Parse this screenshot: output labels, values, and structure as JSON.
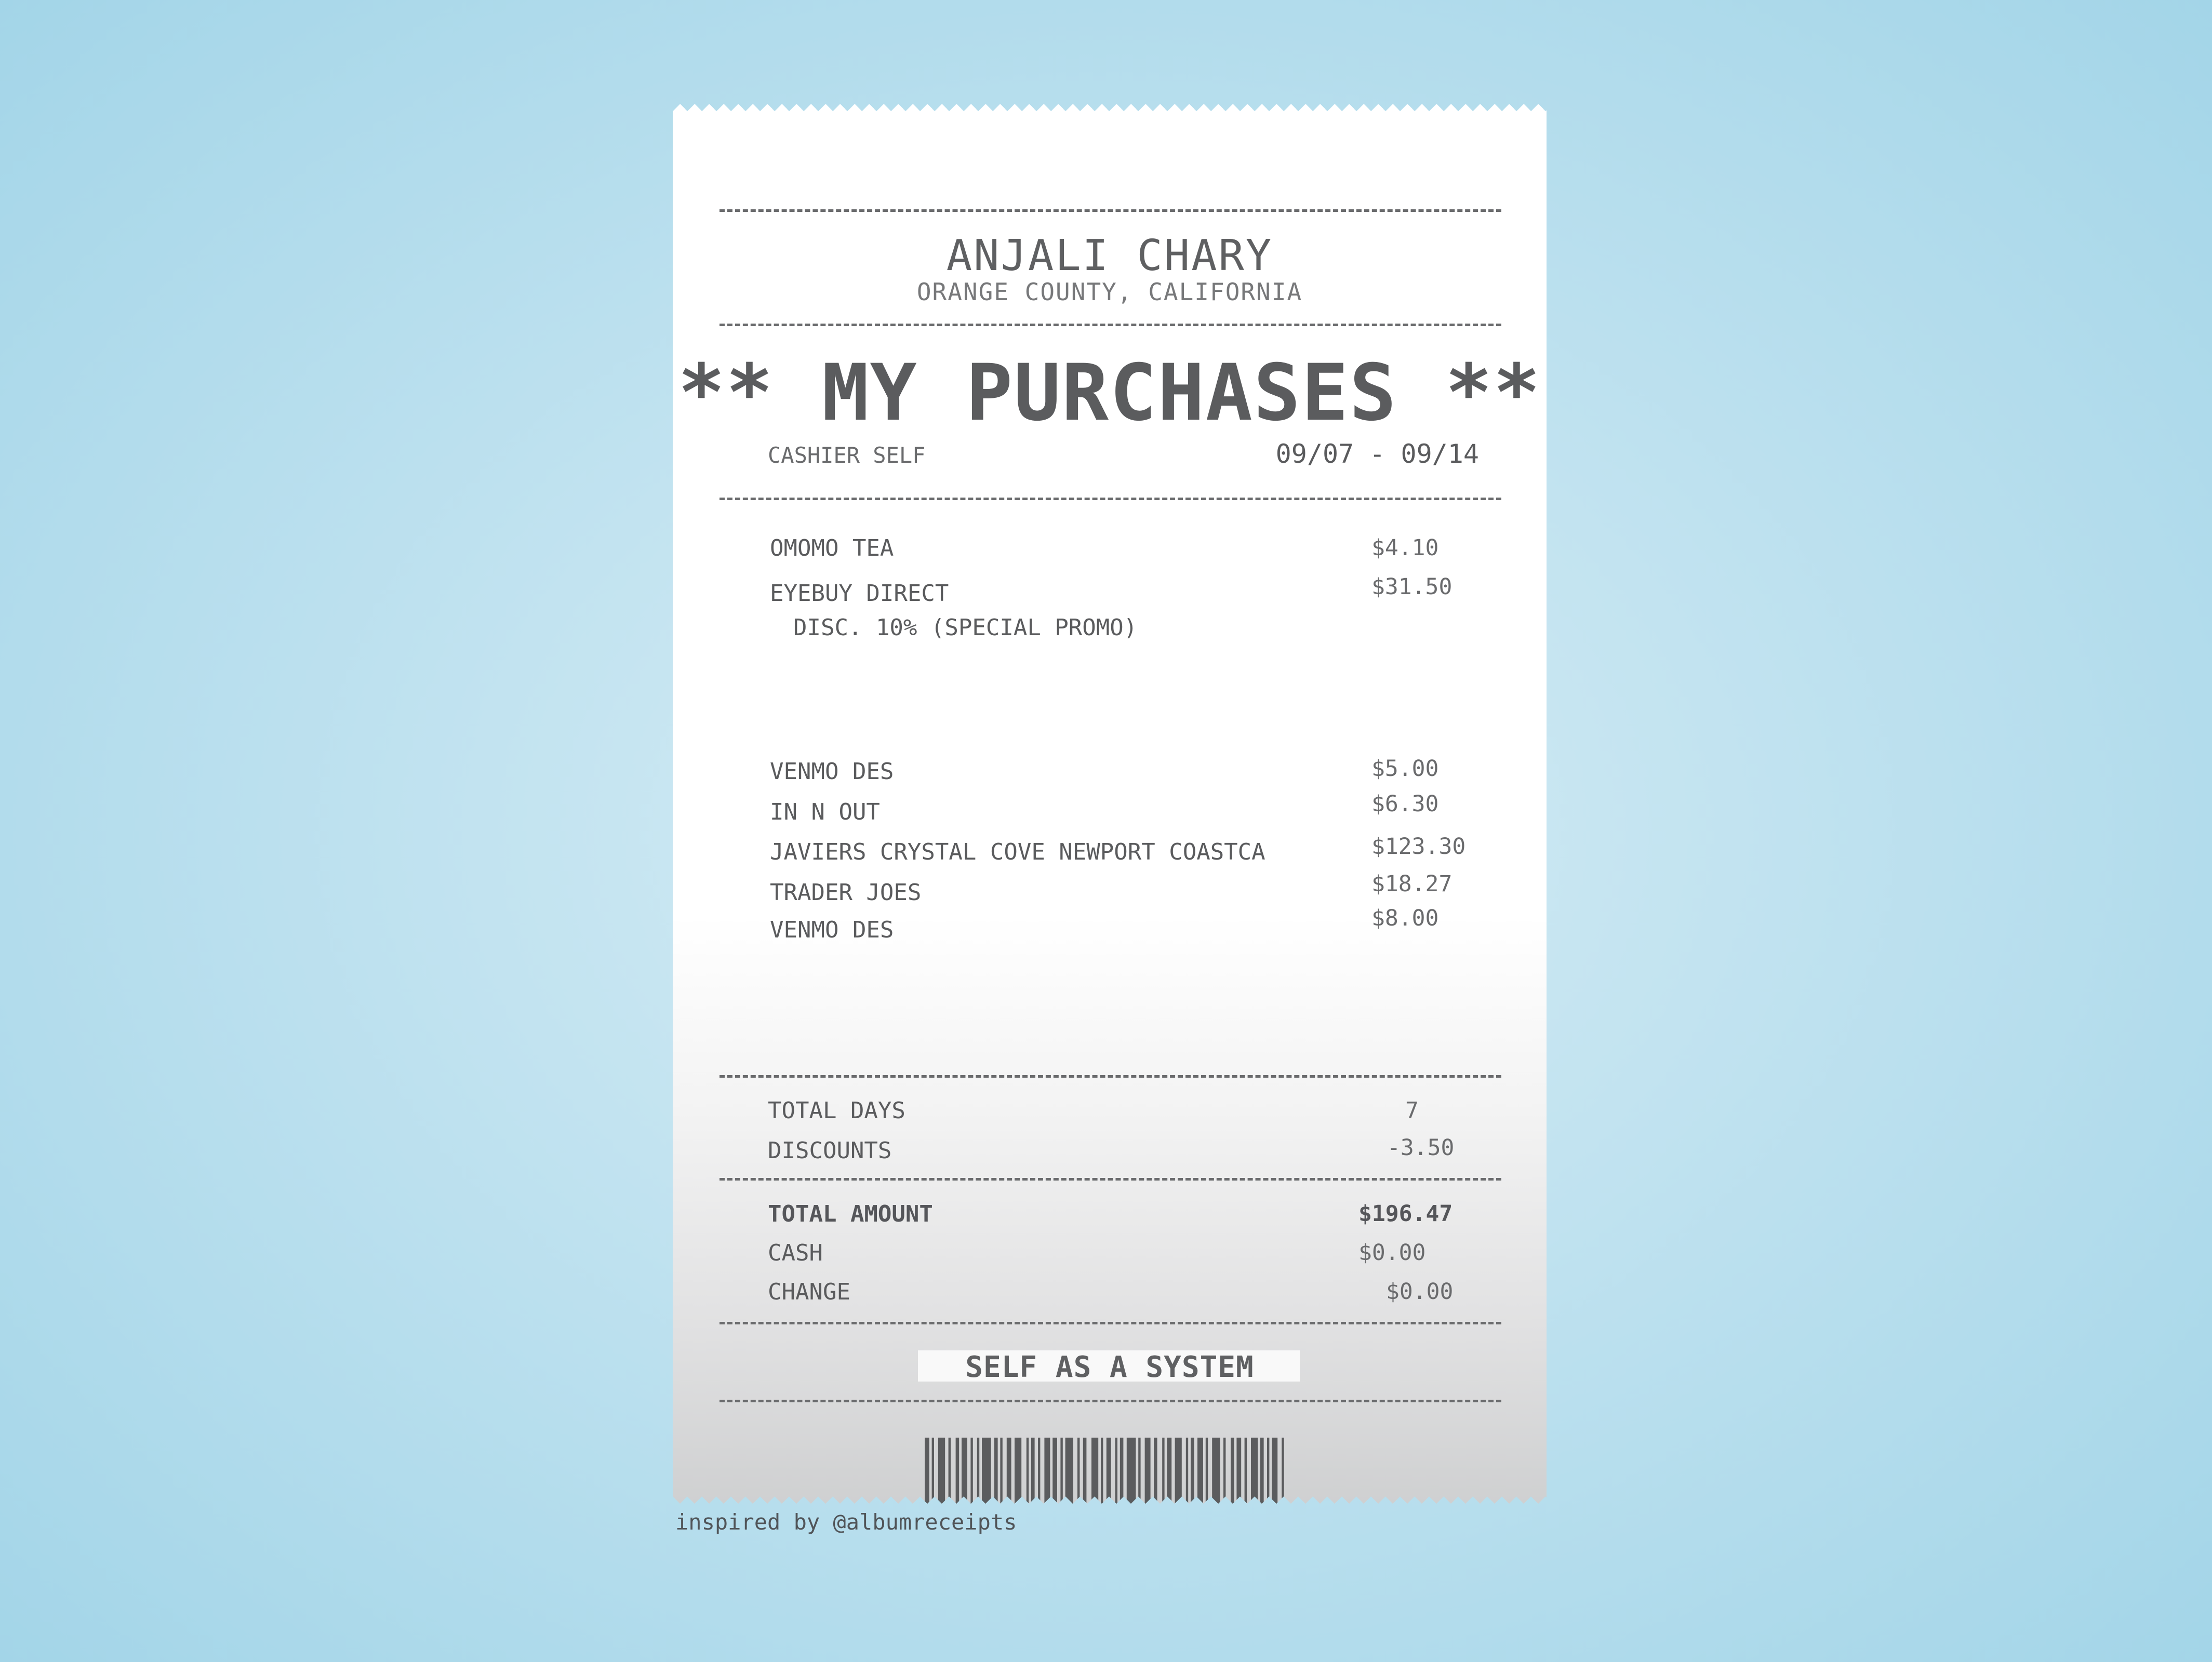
{
  "store": {
    "name": "ANJALI CHARY",
    "location": "ORANGE COUNTY, CALIFORNIA"
  },
  "title": "** MY PURCHASES **",
  "cashier": "CASHIER SELF",
  "date_range": "09/07 - 09/14",
  "items": [
    {
      "name": "OMOMO TEA",
      "price": "$4.10"
    },
    {
      "name": "EYEBUY DIRECT",
      "price": "$31.50",
      "note": "DISC. 10% (SPECIAL PROMO)"
    },
    {
      "name": "VENMO DES",
      "price": "$5.00"
    },
    {
      "name": "IN N OUT",
      "price": "$6.30"
    },
    {
      "name": "JAVIERS CRYSTAL COVE NEWPORT COASTCA",
      "price": "$123.30"
    },
    {
      "name": "TRADER JOES",
      "price": "$18.27"
    },
    {
      "name": "VENMO DES",
      "price": "$8.00"
    }
  ],
  "summary": {
    "total_days_label": "TOTAL DAYS",
    "total_days": "7",
    "discounts_label": "DISCOUNTS",
    "discounts": "-3.50"
  },
  "totals": {
    "total_amount_label": "TOTAL AMOUNT",
    "total_amount": "$196.47",
    "cash_label": "CASH",
    "cash": "$0.00",
    "change_label": "CHANGE",
    "change": "$0.00"
  },
  "footer": "SELF AS A SYSTEM",
  "credit": "inspired by @albumreceipts",
  "colors": {
    "background": "#a3d5e8",
    "ink": "#5f6062",
    "paper": "#ffffff"
  }
}
